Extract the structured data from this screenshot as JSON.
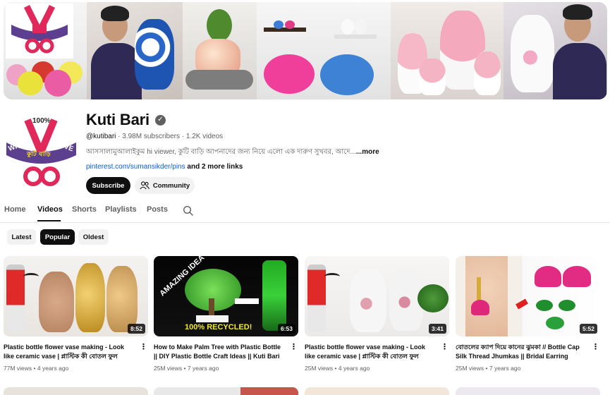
{
  "channel": {
    "name": "Kuti Bari",
    "handle": "@kutibari",
    "subscribers": "3.98M subscribers",
    "videos_count": "1.2K videos",
    "separator": " · ",
    "description": "আসসালামুআলাইকুম hi viewer, কুটি বাড়ি আপনাদের জন্য নিয়ে এলো এক দারুণ সুখবর, আদে...",
    "more_label": "...more",
    "link": "pinterest.com/sumansikder/pins",
    "more_links": " and 2 more links",
    "logo_text_top": "100%",
    "logo_text_with": "WITH",
    "logo_text_love": "LOVE",
    "logo_text_bengali": "কুটি বাড়ি"
  },
  "buttons": {
    "subscribe": "Subscribe",
    "community": "Community"
  },
  "tabs": [
    "Home",
    "Videos",
    "Shorts",
    "Playlists",
    "Posts"
  ],
  "chips": [
    "Latest",
    "Popular",
    "Oldest"
  ],
  "videos": [
    {
      "title": "Plastic bottle flower vase making - Look like ceramic vase | প্লাস্টিক কী বোতল ফুল ফুলদান...",
      "views": "77M views",
      "age": "4 years ago",
      "duration": "8:52"
    },
    {
      "title": "How to Make Palm Tree with Plastic Bottle || DIY Plastic Bottle Craft Ideas || Kuti Bari",
      "views": "25M views",
      "age": "7 years ago",
      "duration": "6:53",
      "thumb_text_amazing": "AMAZING IDEA",
      "thumb_text_recycled": "100% RECYCLED!"
    },
    {
      "title": "Plastic bottle flower vase making - Look like ceramic vase | প্লাস্টিক কী বোতল ফুল ফুলদান...",
      "views": "25M views",
      "age": "4 years ago",
      "duration": "3:41"
    },
    {
      "title": "বোতলের ক্যাপ দিয়ে কানের ঝুমকা // Bottle Cap Silk Thread Jhumkas || Bridal Earring",
      "views": "25M views",
      "age": "7 years ago",
      "duration": "5:52"
    }
  ],
  "colors": {
    "text": "#0f0f0f",
    "secondary_text": "#606060",
    "link": "#065fd4",
    "chip_bg": "#f2f2f2",
    "dark": "#0f0f0f"
  },
  "icons": {
    "verified": "verified-check-icon",
    "community": "community-people-icon",
    "search": "search-icon",
    "more": "kebab-menu-icon"
  }
}
